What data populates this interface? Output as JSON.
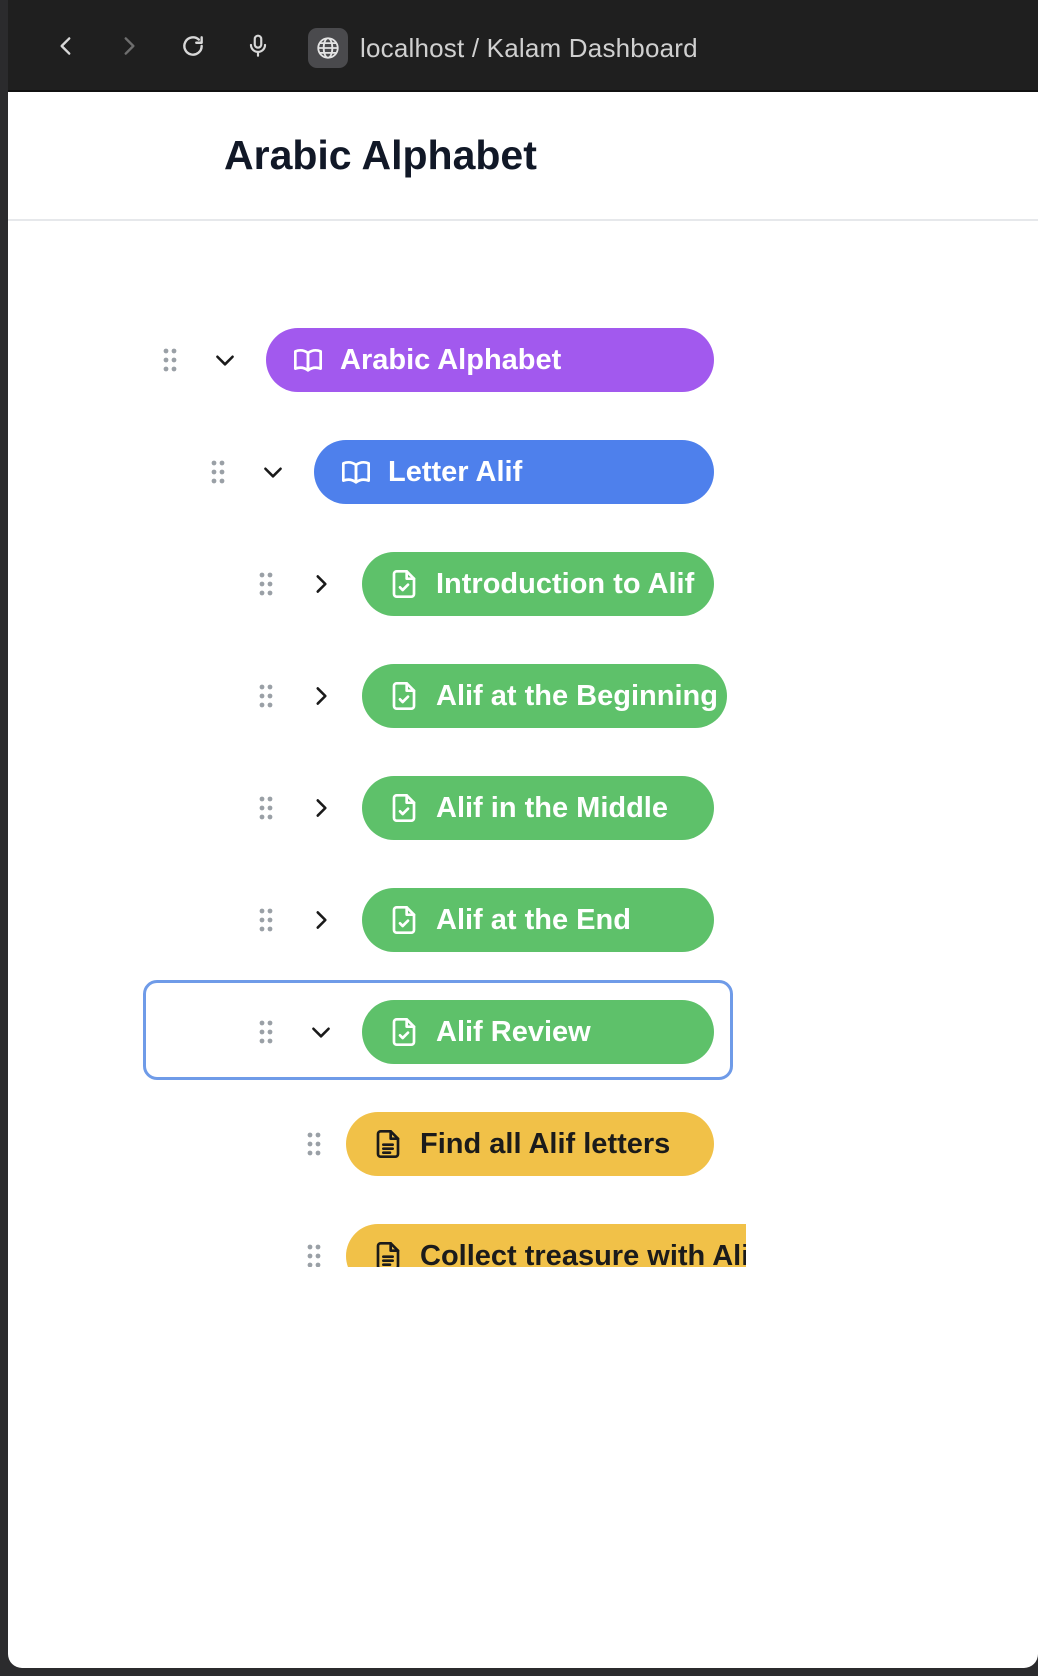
{
  "browser": {
    "url_text": "localhost / Kalam Dashboard"
  },
  "page": {
    "title": "Arabic Alphabet"
  },
  "colors": {
    "course": "#a259ee",
    "unit": "#4e80ec",
    "lesson": "#5ec16a",
    "activity": "#f1c148",
    "selection": "#6f9be8"
  },
  "tree": {
    "items": [
      {
        "label": "Arabic Alphabet",
        "type": "course",
        "icon": "book-icon",
        "expand": "expanded"
      },
      {
        "label": "Letter Alif",
        "type": "unit",
        "icon": "book-icon",
        "expand": "expanded"
      },
      {
        "label": "Introduction to Alif",
        "type": "lesson",
        "icon": "file-check-icon",
        "expand": "collapsed"
      },
      {
        "label": "Alif at the Beginning",
        "type": "lesson",
        "icon": "file-check-icon",
        "expand": "collapsed"
      },
      {
        "label": "Alif in the Middle",
        "type": "lesson",
        "icon": "file-check-icon",
        "expand": "collapsed"
      },
      {
        "label": "Alif at the End",
        "type": "lesson",
        "icon": "file-check-icon",
        "expand": "collapsed"
      },
      {
        "label": "Alif Review",
        "type": "lesson",
        "icon": "file-check-icon",
        "expand": "expanded",
        "selected": true
      },
      {
        "label": "Find all Alif letters",
        "type": "activity",
        "icon": "file-text-icon"
      },
      {
        "label": "Collect treasure with Alif",
        "type": "activity",
        "icon": "file-text-icon"
      }
    ]
  }
}
